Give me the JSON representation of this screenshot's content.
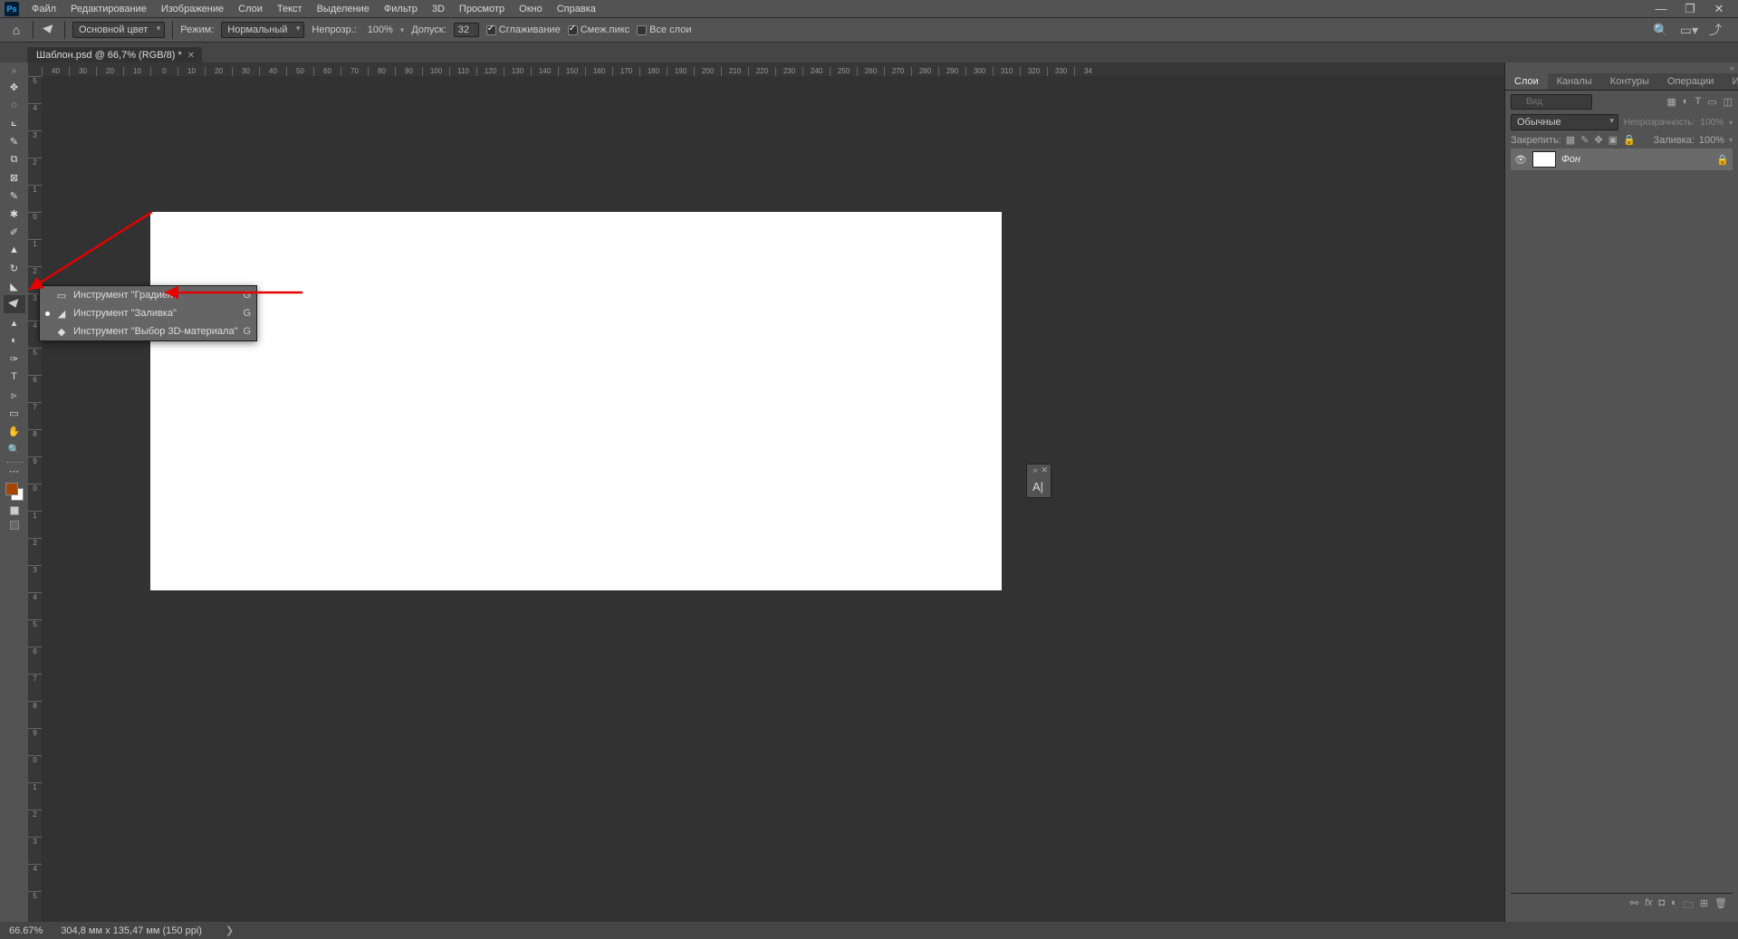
{
  "app_logo": "Ps",
  "menu": [
    "Файл",
    "Редактирование",
    "Изображение",
    "Слои",
    "Текст",
    "Выделение",
    "Фильтр",
    "3D",
    "Просмотр",
    "Окно",
    "Справка"
  ],
  "options": {
    "fill_source": "Основной цвет",
    "mode_label": "Режим:",
    "mode_value": "Нормальный",
    "opacity_label": "Непрозр.:",
    "opacity_value": "100%",
    "tolerance_label": "Допуск:",
    "tolerance_value": "32",
    "antialias": "Сглаживание",
    "contiguous": "Смеж.пикс",
    "all_layers": "Все слои"
  },
  "doc_tab": "Шаблон.psd @ 66,7% (RGB/8) *",
  "ruler_h": [
    "40",
    "30",
    "20",
    "10",
    "0",
    "10",
    "20",
    "30",
    "40",
    "50",
    "60",
    "70",
    "80",
    "90",
    "100",
    "110",
    "120",
    "130",
    "140",
    "150",
    "160",
    "170",
    "180",
    "190",
    "200",
    "210",
    "220",
    "230",
    "240",
    "250",
    "260",
    "270",
    "280",
    "290",
    "300",
    "310",
    "320",
    "330",
    "34"
  ],
  "ruler_v": [
    "5",
    "4",
    "3",
    "2",
    "1",
    "0",
    "1",
    "2",
    "3",
    "4",
    "5",
    "6",
    "7",
    "8",
    "9",
    "0",
    "1",
    "2",
    "3",
    "4",
    "5",
    "6",
    "7",
    "8",
    "9",
    "0",
    "1",
    "2",
    "3",
    "4",
    "5"
  ],
  "submenu": [
    {
      "label": "Инструмент \"Градиент\"",
      "shortcut": "G",
      "selected": false,
      "icon": "gradient"
    },
    {
      "label": "Инструмент \"Заливка\"",
      "shortcut": "G",
      "selected": true,
      "icon": "bucket"
    },
    {
      "label": "Инструмент \"Выбор 3D-материала\"",
      "shortcut": "G",
      "selected": false,
      "icon": "3d"
    }
  ],
  "float_panel": {
    "text": "А|"
  },
  "panels": {
    "tabs": [
      "Слои",
      "Каналы",
      "Контуры",
      "Операции",
      "История"
    ],
    "active_tab": 0,
    "search_placeholder": "Вид",
    "blend_mode": "Обычные",
    "opacity_label": "Непрозрачность:",
    "opacity_value": "100%",
    "lock_label": "Закрепить:",
    "fill_label": "Заливка:",
    "fill_value": "100%",
    "layer": {
      "name": "Фон"
    }
  },
  "status": {
    "zoom": "66.67%",
    "doc_info": "304,8 мм x 135,47 мм (150 ppi)"
  }
}
